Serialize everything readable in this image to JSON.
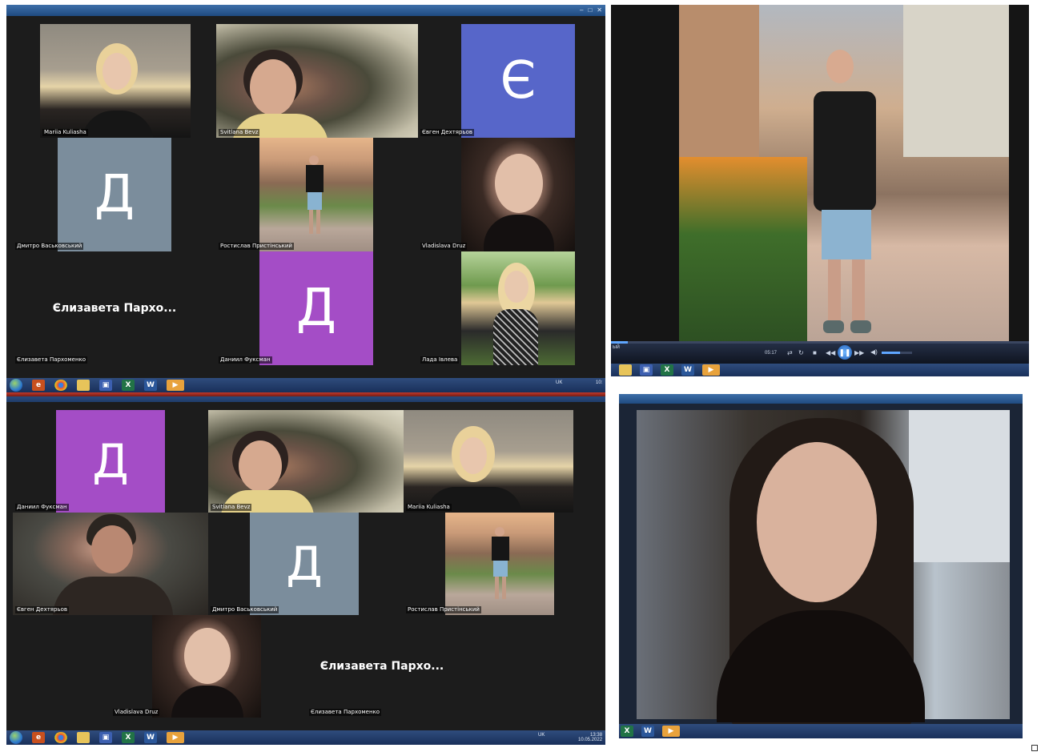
{
  "screen1": {
    "tiles": [
      {
        "name": "Mariia Kuliasha"
      },
      {
        "name": "Svitlana Bevz"
      },
      {
        "name": "Євген Дехтярьов",
        "initial": "Є",
        "color": "#5766c9"
      },
      {
        "name": "Дмитро Васьковський",
        "initial": "Д",
        "color": "#7b8d9c"
      },
      {
        "name": "Ростислав Пристінський"
      },
      {
        "name": "Vladislava Druz"
      },
      {
        "name": "Єлизавета Пархоменко",
        "display": "Єлизавета  Пархо..."
      },
      {
        "name": "Даниил Фуксман",
        "initial": "Д",
        "color": "#a44dc6"
      },
      {
        "name": "Лада Івлева"
      }
    ],
    "tray": {
      "lang": "UK",
      "time": "10:"
    }
  },
  "screen2": {
    "tiles": [
      {
        "name": "Даниил Фуксман",
        "initial": "Д",
        "color": "#a44dc6"
      },
      {
        "name": "Svitlana Bevz"
      },
      {
        "name": "Mariia Kuliasha"
      },
      {
        "name": "Євген Дехтярьов"
      },
      {
        "name": "Дмитро Васьковський",
        "initial": "Д",
        "color": "#7b8d9c"
      },
      {
        "name": "Ростислав Пристінський"
      },
      {
        "name": "Vladislava Druz"
      },
      {
        "name": "Єлизавета Пархоменко",
        "display": "Єлизавета  Пархо..."
      }
    ],
    "tray": {
      "lang": "UK",
      "time": "13:38",
      "date": "10.05.2022"
    }
  },
  "player": {
    "left_label": "ый",
    "time": "05:17",
    "progress": 0.04,
    "volume": 0.6
  },
  "taskbar_icons": [
    "explorer",
    "chrome",
    "folder",
    "save",
    "excel",
    "word",
    "media"
  ]
}
